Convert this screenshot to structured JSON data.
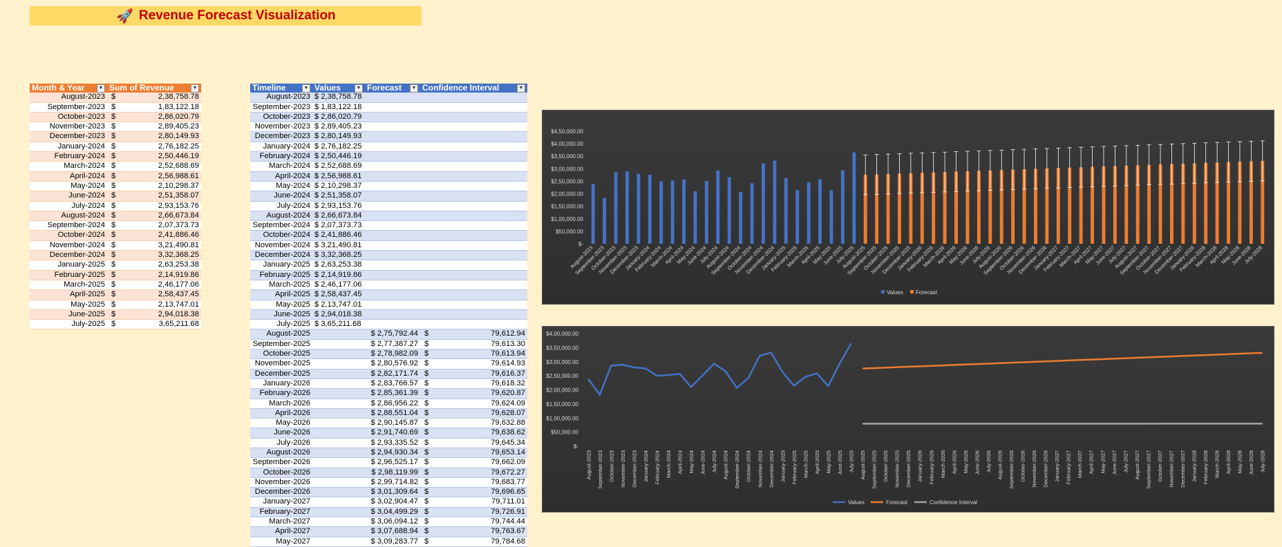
{
  "title": "Revenue Forecast Visualization",
  "title_icon": "rocket-icon",
  "revenue_table": {
    "headers": [
      "Month & Year",
      "Sum of Revenue"
    ],
    "rows": [
      [
        "August-2023",
        "$",
        "2,38,758.78"
      ],
      [
        "September-2023",
        "$",
        "1,83,122.18"
      ],
      [
        "October-2023",
        "$",
        "2,86,020.79"
      ],
      [
        "November-2023",
        "$",
        "2,89,405.23"
      ],
      [
        "December-2023",
        "$",
        "2,80,149.93"
      ],
      [
        "January-2024",
        "$",
        "2,76,182.25"
      ],
      [
        "February-2024",
        "$",
        "2,50,446.19"
      ],
      [
        "March-2024",
        "$",
        "2,52,688.69"
      ],
      [
        "April-2024",
        "$",
        "2,56,988.61"
      ],
      [
        "May-2024",
        "$",
        "2,10,298.37"
      ],
      [
        "June-2024",
        "$",
        "2,51,358.07"
      ],
      [
        "July-2024",
        "$",
        "2,93,153.76"
      ],
      [
        "August-2024",
        "$",
        "2,66,673.84"
      ],
      [
        "September-2024",
        "$",
        "2,07,373.73"
      ],
      [
        "October-2024",
        "$",
        "2,41,886.46"
      ],
      [
        "November-2024",
        "$",
        "3,21,490.81"
      ],
      [
        "December-2024",
        "$",
        "3,32,368.25"
      ],
      [
        "January-2025",
        "$",
        "2,63,253.38"
      ],
      [
        "February-2025",
        "$",
        "2,14,919.86"
      ],
      [
        "March-2025",
        "$",
        "2,46,177.06"
      ],
      [
        "April-2025",
        "$",
        "2,58,437.45"
      ],
      [
        "May-2025",
        "$",
        "2,13,747.01"
      ],
      [
        "June-2025",
        "$",
        "2,94,018.38"
      ],
      [
        "July-2025",
        "$",
        "3,65,211.68"
      ]
    ]
  },
  "forecast_table": {
    "headers": [
      "Timeline",
      "Values",
      "Forecast",
      "Confidence Interval"
    ],
    "rows": [
      [
        "August-2023",
        "$ 2,38,758.78",
        "",
        "",
        ""
      ],
      [
        "September-2023",
        "$ 1,83,122.18",
        "",
        "",
        ""
      ],
      [
        "October-2023",
        "$ 2,86,020.79",
        "",
        "",
        ""
      ],
      [
        "November-2023",
        "$ 2,89,405.23",
        "",
        "",
        ""
      ],
      [
        "December-2023",
        "$ 2,80,149.93",
        "",
        "",
        ""
      ],
      [
        "January-2024",
        "$ 2,76,182.25",
        "",
        "",
        ""
      ],
      [
        "February-2024",
        "$ 2,50,446.19",
        "",
        "",
        ""
      ],
      [
        "March-2024",
        "$ 2,52,688.69",
        "",
        "",
        ""
      ],
      [
        "April-2024",
        "$ 2,56,988.61",
        "",
        "",
        ""
      ],
      [
        "May-2024",
        "$ 2,10,298.37",
        "",
        "",
        ""
      ],
      [
        "June-2024",
        "$ 2,51,358.07",
        "",
        "",
        ""
      ],
      [
        "July-2024",
        "$ 2,93,153.76",
        "",
        "",
        ""
      ],
      [
        "August-2024",
        "$ 2,66,673.84",
        "",
        "",
        ""
      ],
      [
        "September-2024",
        "$ 2,07,373.73",
        "",
        "",
        ""
      ],
      [
        "October-2024",
        "$ 2,41,886.46",
        "",
        "",
        ""
      ],
      [
        "November-2024",
        "$ 3,21,490.81",
        "",
        "",
        ""
      ],
      [
        "December-2024",
        "$ 3,32,368.25",
        "",
        "",
        ""
      ],
      [
        "January-2025",
        "$ 2,63,253.38",
        "",
        "",
        ""
      ],
      [
        "February-2025",
        "$ 2,14,919.86",
        "",
        "",
        ""
      ],
      [
        "March-2025",
        "$ 2,46,177.06",
        "",
        "",
        ""
      ],
      [
        "April-2025",
        "$ 2,58,437.45",
        "",
        "",
        ""
      ],
      [
        "May-2025",
        "$ 2,13,747.01",
        "",
        "",
        ""
      ],
      [
        "June-2025",
        "$ 2,94,018.38",
        "",
        "",
        ""
      ],
      [
        "July-2025",
        "$ 3,65,211.68",
        "",
        "",
        ""
      ],
      [
        "August-2025",
        "",
        "$ 2,75,792.44",
        "$",
        "79,612.94"
      ],
      [
        "September-2025",
        "",
        "$ 2,77,387.27",
        "$",
        "79,613.30"
      ],
      [
        "October-2025",
        "",
        "$ 2,78,982.09",
        "$",
        "79,613.94"
      ],
      [
        "November-2025",
        "",
        "$ 2,80,576.92",
        "$",
        "79,614.93"
      ],
      [
        "December-2025",
        "",
        "$ 2,82,171.74",
        "$",
        "79,616.37"
      ],
      [
        "January-2026",
        "",
        "$ 2,83,766.57",
        "$",
        "79,618.32"
      ],
      [
        "February-2026",
        "",
        "$ 2,85,361.39",
        "$",
        "79,620.87"
      ],
      [
        "March-2026",
        "",
        "$ 2,86,956.22",
        "$",
        "79,624.09"
      ],
      [
        "April-2026",
        "",
        "$ 2,88,551.04",
        "$",
        "79,628.07"
      ],
      [
        "May-2026",
        "",
        "$ 2,90,145.87",
        "$",
        "79,632.88"
      ],
      [
        "June-2026",
        "",
        "$ 2,91,740.69",
        "$",
        "79,638.62"
      ],
      [
        "July-2026",
        "",
        "$ 2,93,335.52",
        "$",
        "79,645.34"
      ],
      [
        "August-2026",
        "",
        "$ 2,94,930.34",
        "$",
        "79,653.14"
      ],
      [
        "September-2026",
        "",
        "$ 2,96,525.17",
        "$",
        "79,662.09"
      ],
      [
        "October-2026",
        "",
        "$ 2,98,119.99",
        "$",
        "79,672.27"
      ],
      [
        "November-2026",
        "",
        "$ 2,99,714.82",
        "$",
        "79,683.77"
      ],
      [
        "December-2026",
        "",
        "$ 3,01,309.64",
        "$",
        "79,696.65"
      ],
      [
        "January-2027",
        "",
        "$ 3,02,904.47",
        "$",
        "79,711.01"
      ],
      [
        "February-2027",
        "",
        "$ 3,04,499.29",
        "$",
        "79,726.91"
      ],
      [
        "March-2027",
        "",
        "$ 3,06,094.12",
        "$",
        "79,744.44"
      ],
      [
        "April-2027",
        "",
        "$ 3,07,688.94",
        "$",
        "79,763.67"
      ],
      [
        "May-2027",
        "",
        "$ 3,09,283.77",
        "$",
        "79,784.68"
      ]
    ]
  },
  "chart_data": [
    {
      "type": "bar",
      "yticks": [
        "$-",
        "$50,000.00",
        "$1,00,000.00",
        "$1,50,000.00",
        "$2,00,000.00",
        "$2,50,000.00",
        "$3,00,000.00",
        "$3,50,000.00",
        "$4,00,000.00",
        "$4,50,000.00"
      ],
      "ylim": [
        0,
        450000
      ],
      "legend": [
        "Values",
        "Forecast"
      ],
      "legend_position": "bottom",
      "colors": {
        "Values": "#4472c4",
        "Forecast": "#ed7d31",
        "error": "#ffffff"
      }
    },
    {
      "type": "line",
      "yticks": [
        "$-",
        "$50,000.00",
        "$1,00,000.00",
        "$1,50,000.00",
        "$2,00,000.00",
        "$2,50,000.00",
        "$3,00,000.00",
        "$3,50,000.00",
        "$4,00,000.00"
      ],
      "ylim": [
        0,
        400000
      ],
      "legend": [
        "Values",
        "Forecast",
        "Confidence Interval"
      ],
      "legend_position": "bottom",
      "colors": {
        "Values": "#4472c4",
        "Forecast": "#ed7d31",
        "Confidence Interval": "#a5a5a5"
      }
    }
  ],
  "categories": [
    "August-2023",
    "September-2023",
    "October-2023",
    "November-2023",
    "December-2023",
    "January-2024",
    "February-2024",
    "March-2024",
    "April-2024",
    "May-2024",
    "June-2024",
    "July-2024",
    "August-2024",
    "September-2024",
    "October-2024",
    "November-2024",
    "December-2024",
    "January-2025",
    "February-2025",
    "March-2025",
    "April-2025",
    "May-2025",
    "June-2025",
    "July-2025",
    "August-2025",
    "September-2025",
    "October-2025",
    "November-2025",
    "December-2025",
    "January-2026",
    "February-2026",
    "March-2026",
    "April-2026",
    "May-2026",
    "June-2026",
    "July-2026",
    "August-2026",
    "September-2026",
    "October-2026",
    "November-2026",
    "December-2026",
    "January-2027",
    "February-2027",
    "March-2027",
    "April-2027",
    "May-2027",
    "June-2027",
    "July-2027",
    "August-2027",
    "September-2027",
    "October-2027",
    "November-2027",
    "December-2027",
    "January-2028",
    "February-2028",
    "March-2028",
    "April-2028",
    "May-2028",
    "June-2028",
    "July-2028"
  ],
  "values_series": [
    238758.78,
    183122.18,
    286020.79,
    289405.23,
    280149.93,
    276182.25,
    250446.19,
    252688.69,
    256988.61,
    210298.37,
    251358.07,
    293153.76,
    266673.84,
    207373.73,
    241886.46,
    321490.81,
    332368.25,
    263253.38,
    214919.86,
    246177.06,
    258437.45,
    213747.01,
    294018.38,
    365211.68
  ],
  "forecast_start": 275792.44,
  "forecast_step": 1594.83,
  "confidence_interval": [
    79612.94,
    79613.3,
    79613.94,
    79614.93,
    79616.37,
    79618.32,
    79620.87,
    79624.09,
    79628.07,
    79632.88,
    79638.62,
    79645.34,
    79653.14,
    79662.09,
    79672.27,
    79683.77,
    79696.65,
    79711.01,
    79726.91,
    79744.44,
    79763.67,
    79784.68
  ]
}
